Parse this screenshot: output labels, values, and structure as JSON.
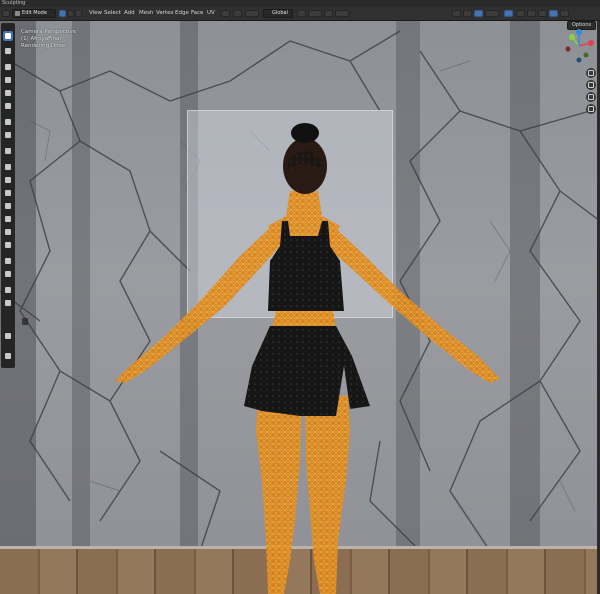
{
  "workspace": {
    "title": "Sculpting"
  },
  "header": {
    "mode": "Edit Mode",
    "menus": [
      "View",
      "Select",
      "Add",
      "Mesh",
      "Vertex",
      "Edge",
      "Face",
      "UV"
    ],
    "transform_orientation": "Global",
    "options_label": "Options"
  },
  "viewport": {
    "view_name": "Camera Perspective",
    "object_name": "(1) AfroyaFinal",
    "status": "Rendering Done"
  },
  "colors": {
    "header_bg": "#303030",
    "active_blue": "#4772b3",
    "wireframe_orange": "#ff9a1a",
    "wall_gray": "#939599"
  },
  "toolbar": {
    "tools": [
      "select-box-icon",
      "cursor-icon",
      "move-icon",
      "rotate-icon",
      "scale-icon",
      "transform-icon",
      "annotate-icon",
      "measure-icon",
      "add-cube-icon",
      "extrude-icon",
      "inset-icon",
      "bevel-icon",
      "loop-cut-icon",
      "knife-icon",
      "poly-build-icon",
      "spin-icon",
      "smooth-icon",
      "edge-slide-icon",
      "shrink-fatten-icon",
      "shear-icon",
      "rip-icon",
      "extra-icon"
    ]
  },
  "nav_gizmo": {
    "axes": [
      "x-axis",
      "y-axis",
      "z-axis"
    ],
    "buttons": [
      "zoom-icon",
      "pan-icon",
      "camera-view-icon",
      "perspective-icon"
    ]
  }
}
